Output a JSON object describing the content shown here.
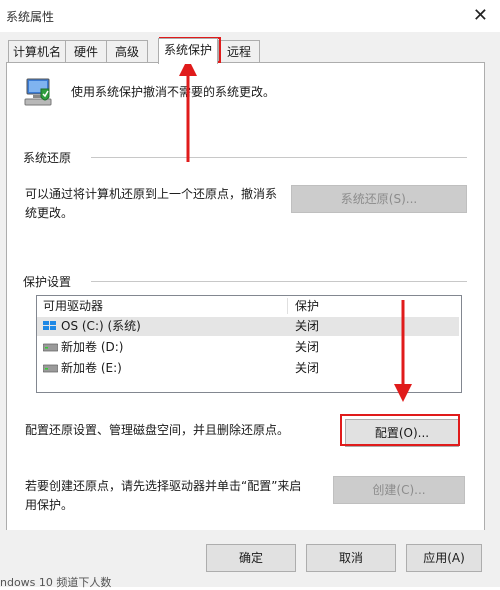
{
  "window": {
    "title": "系统属性"
  },
  "tabs": [
    {
      "label": "计算机名"
    },
    {
      "label": "硬件"
    },
    {
      "label": "高级"
    },
    {
      "label": "系统保护"
    },
    {
      "label": "远程"
    }
  ],
  "intro": {
    "text": "使用系统保护撤消不需要的系统更改。"
  },
  "restore": {
    "group_title": "系统还原",
    "desc_line1": "可以通过将计算机还原到上一个还原点，撤消系",
    "desc_line2": "统更改。",
    "button": "系统还原(S)..."
  },
  "protection": {
    "group_title": "保护设置",
    "columns": {
      "drive": "可用驱动器",
      "protect": "保护"
    },
    "drives": [
      {
        "name": "OS (C:) (系统)",
        "status": "关闭"
      },
      {
        "name": "新加卷 (D:)",
        "status": "关闭"
      },
      {
        "name": "新加卷 (E:)",
        "status": "关闭"
      }
    ],
    "configure_text": "配置还原设置、管理磁盘空间，并且删除还原点。",
    "configure_button": "配置(O)...",
    "create_text_line1": "若要创建还原点，请先选择驱动器并单击“配置”来启",
    "create_text_line2": "用保护。",
    "create_button": "创建(C)..."
  },
  "footer": {
    "ok": "确定",
    "cancel": "取消",
    "apply": "应用(A)",
    "background_text": "ndows 10 频道下人数"
  }
}
